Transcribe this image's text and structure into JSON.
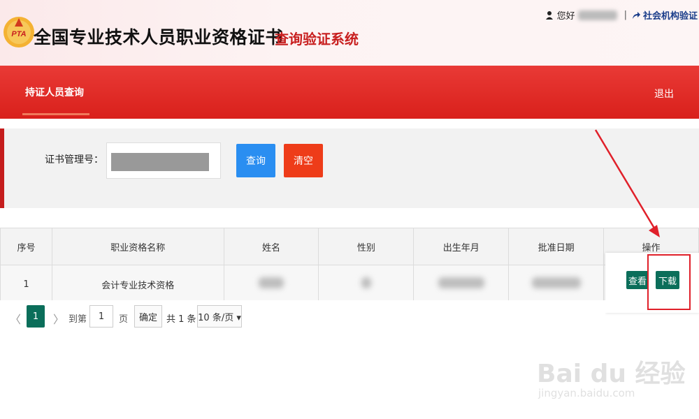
{
  "header": {
    "logo_text": "PTA",
    "title_main": "全国专业技术人员职业资格证书",
    "title_sub": "查询验证系统",
    "greeting": "您好",
    "org_link": "社会机构验证"
  },
  "nav": {
    "active_tab": "持证人员查询",
    "logout": "退出"
  },
  "search": {
    "label": "证书管理号：",
    "query_button": "查询",
    "clear_button": "清空"
  },
  "table": {
    "headers": [
      "序号",
      "职业资格名称",
      "姓名",
      "性别",
      "出生年月",
      "批准日期",
      "操作"
    ],
    "rows": [
      {
        "index": "1",
        "qualification": "会计专业技术资格"
      }
    ],
    "view_button": "查看",
    "download_button": "下载"
  },
  "pager": {
    "prev": "〈",
    "current_page": "1",
    "next": "〉",
    "goto_label": "到第",
    "goto_value": "1",
    "page_label": "页",
    "confirm": "确定",
    "total": "共 1 条",
    "page_size": "10 条/页 ▾"
  },
  "watermark": {
    "text": "Bai du 经验",
    "url": "jingyan.baidu.com"
  },
  "colors": {
    "nav_red": "#d9201b",
    "query_blue": "#2a8ef1",
    "clear_orange": "#ee3c19",
    "op_green": "#0b6e5a",
    "highlight_red": "#e0202a"
  }
}
